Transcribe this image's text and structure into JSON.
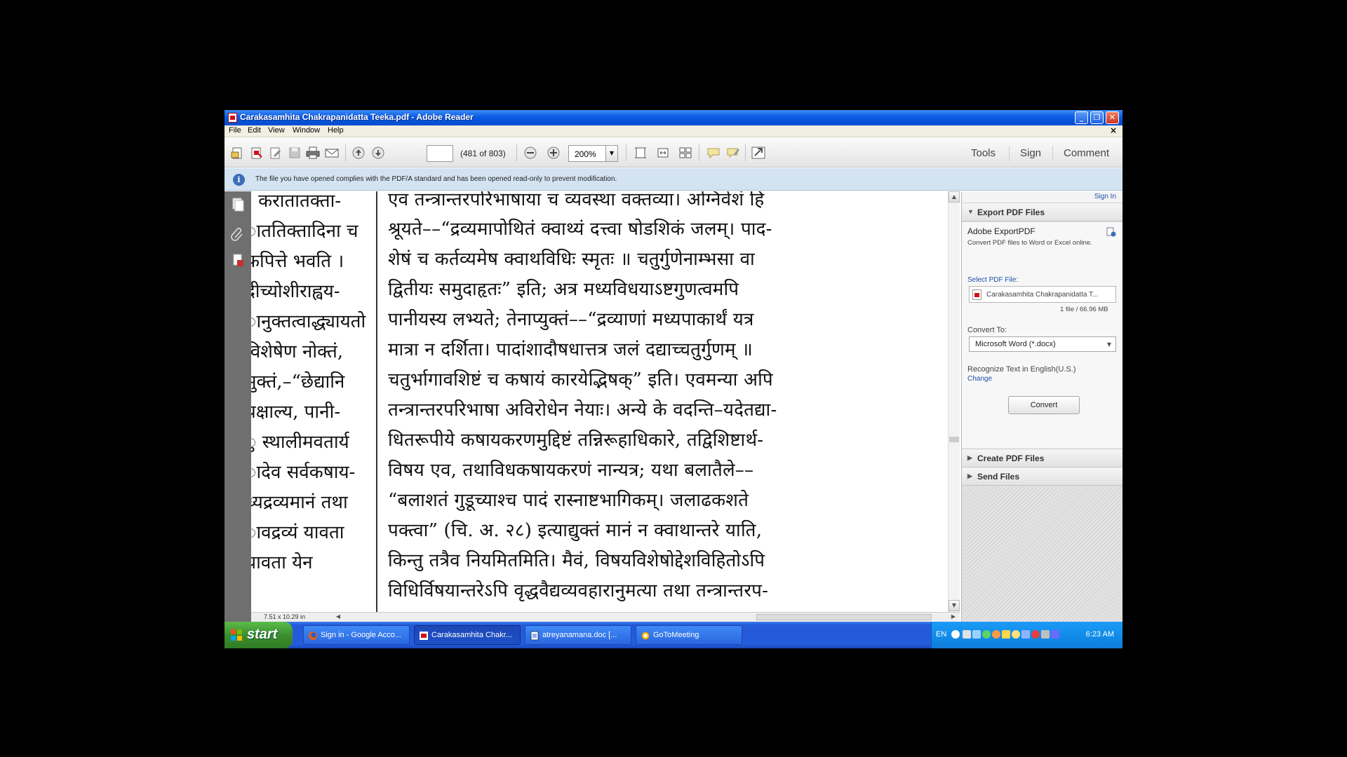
{
  "window": {
    "title": "Carakasamhita Chakrapanidatta Teeka.pdf - Adobe Reader",
    "minimize": "_",
    "maximize": "❐",
    "close": "✕"
  },
  "menu": {
    "items": [
      "File",
      "Edit",
      "View",
      "Window",
      "Help"
    ],
    "doc_close": "×"
  },
  "toolbar": {
    "page_value": "",
    "page_count": "(481 of 803)",
    "zoom": "200%",
    "tools": "Tools",
    "sign": "Sign",
    "comment": "Comment"
  },
  "infobar": {
    "icon": "i",
    "text": "The file you have opened complies with the PDF/A standard and has been opened read-only to prevent modification."
  },
  "document": {
    "left_lines": [
      "। करातातक्ता-",
      "ाततिक्तादिना च",
      "फपित्ते भवति ।",
      "दीच्योशीराह्वय-",
      "ानुक्तत्वाद्ध्यायतो",
      "विशेषेण नोक्तं,",
      "मुक्तं,–“छेद्यानि",
      "प्रक्षाल्य, पानी-",
      "ु स्थालीमवतार्य",
      "ादेव सर्वकषाय-",
      "ध्यद्रव्यमानं तथा",
      "ावद्रव्यं यावता",
      "यावता येन"
    ],
    "main_lines": [
      "एव तन्त्रान्तरपरिभाषाया च व्यवस्था वक्तव्या। अग्निवेशं हि",
      "श्रूयते––“द्रव्यमापोथितं क्वाथ्यं दत्त्वा षोडशिकं जलम्। पाद-",
      "शेषं च कर्तव्यमेष क्वाथविधिः स्मृतः ॥ चतुर्गुणेनाम्भसा वा",
      "द्वितीयः समुदाहृतः” इति; अत्र मध्यविधयाऽष्टगुणत्वमपि",
      "पानीयस्य लभ्यते; तेनाप्युक्तं––“द्रव्याणां मध्यपाकार्थं यत्र",
      "मात्रा न दर्शिता। पादांशादौषधात्तत्र जलं दद्याच्चतुर्गुणम् ॥",
      "चतुर्भागावशिष्टं च कषायं कारयेद्भिषक्” इति। एवमन्या अपि",
      "तन्त्रान्तरपरिभाषा अविरोधेन नेयाः। अन्ये के वदन्ति–यदेतद्या-",
      "धितरूपीये कषायकरणमुद्दिष्टं तन्निरूहाधिकारे, तद्विशिष्टार्थ-",
      "विषय एव, तथाविधकषायकरणं नान्यत्र; यथा बलातैले––",
      "“बलाशतं गुडूच्याश्च पादं रास्नाष्टभागिकम्। जलाढकशते",
      "पक्त्वा” (चि. अ. २८) इत्याद्युक्तं मानं न क्वाथान्तरे याति,",
      "किन्तु तत्रैव नियमितमिति। मैवं, विषयविशेषोद्देशविहितोऽपि",
      "विधिर्विषयान्तरेऽपि वृद्धवैद्यव्यवहारानुमत्या तथा तन्त्रान्तरप-"
    ]
  },
  "status": {
    "page_size": "7.51 x 10.29 in"
  },
  "rightpane": {
    "sign_in": "Sign In",
    "export_section": "Export PDF Files",
    "export_title": "Adobe ExportPDF",
    "export_desc": "Convert PDF files to Word or Excel online.",
    "select_label": "Select PDF File:",
    "file_name": "Carakasamhita Chakrapanidatta T...",
    "file_info": "1 file / 66.96 MB",
    "convert_to_label": "Convert To:",
    "convert_to_value": "Microsoft Word (*.docx)",
    "recognize_text": "Recognize Text in English(U.S.)",
    "change_link": "Change",
    "convert_button": "Convert",
    "create_section": "Create PDF Files",
    "send_section": "Send Files"
  },
  "taskbar": {
    "start": "start",
    "tasks": [
      "Sign in - Google Acco...",
      "Carakasamhita Chakr...",
      "atreyanamana.doc [...",
      "GoToMeeting"
    ],
    "lang": "EN",
    "clock": "6:23 AM"
  },
  "colors": {
    "title_blue": "#0a5ce6",
    "taskbar_blue": "#245cdc",
    "start_green": "#3c8f2f",
    "info_bg": "#d4e3f1",
    "link_blue": "#1a4fa8"
  }
}
